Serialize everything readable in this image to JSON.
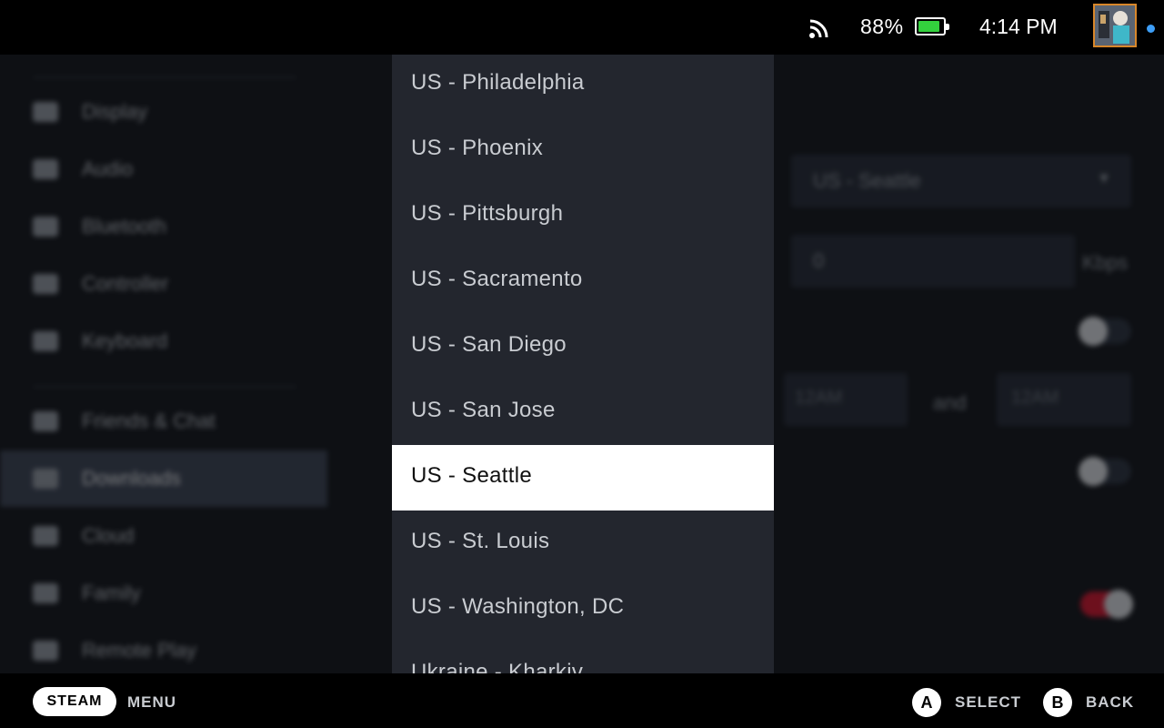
{
  "status": {
    "battery_percent": "88%",
    "battery_level": 0.88,
    "time": "4:14 PM",
    "icons": [
      "wifi-icon",
      "battery-icon",
      "avatar",
      "notification-dot"
    ]
  },
  "dropdown": {
    "options": [
      "US - Philadelphia",
      "US - Phoenix",
      "US - Pittsburgh",
      "US - Sacramento",
      "US - San Diego",
      "US - San Jose",
      "US - Seattle",
      "US - St. Louis",
      "US - Washington, DC",
      "Ukraine - Kharkiv"
    ],
    "selected_index": 6
  },
  "background": {
    "sidebar": [
      {
        "label": "Display",
        "icon": "display-icon"
      },
      {
        "label": "Audio",
        "icon": "audio-icon"
      },
      {
        "label": "Bluetooth",
        "icon": "bluetooth-icon"
      },
      {
        "label": "Controller",
        "icon": "controller-icon"
      },
      {
        "label": "Keyboard",
        "icon": "keyboard-icon"
      },
      {
        "label": "Friends & Chat",
        "icon": "friends-icon"
      },
      {
        "label": "Downloads",
        "icon": "download-icon",
        "active": true
      },
      {
        "label": "Cloud",
        "icon": "cloud-icon"
      },
      {
        "label": "Family",
        "icon": "family-icon"
      },
      {
        "label": "Remote Play",
        "icon": "remote-play-icon"
      }
    ],
    "region_value": "US - Seattle",
    "limit_value": "0",
    "limit_unit": "Kbps",
    "schedule_from": "12AM",
    "schedule_and": "and",
    "schedule_to": "12AM"
  },
  "footer": {
    "steam_label": "STEAM",
    "menu_label": "MENU",
    "a_glyph": "A",
    "select_label": "SELECT",
    "b_glyph": "B",
    "back_label": "BACK"
  },
  "colors": {
    "accent_toggle_on": "#e0102a",
    "battery_fill": "#33d13d",
    "notification": "#3d9ef7",
    "dropdown_bg": "#23262e",
    "selected_bg": "#ffffff"
  }
}
